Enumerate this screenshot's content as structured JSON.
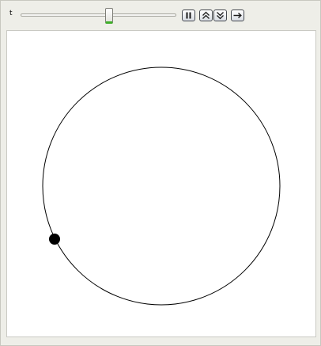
{
  "controls": {
    "parameter_label": "t",
    "slider_value_fraction": 0.57,
    "pause_icon": "pause-icon",
    "faster_icon": "double-chevron-up-icon",
    "slower_icon": "double-chevron-down-icon",
    "direction_icon": "right-arrow-icon"
  },
  "plot": {
    "shape": "circle",
    "point_color": "#000000",
    "curve_color": "#000000"
  }
}
